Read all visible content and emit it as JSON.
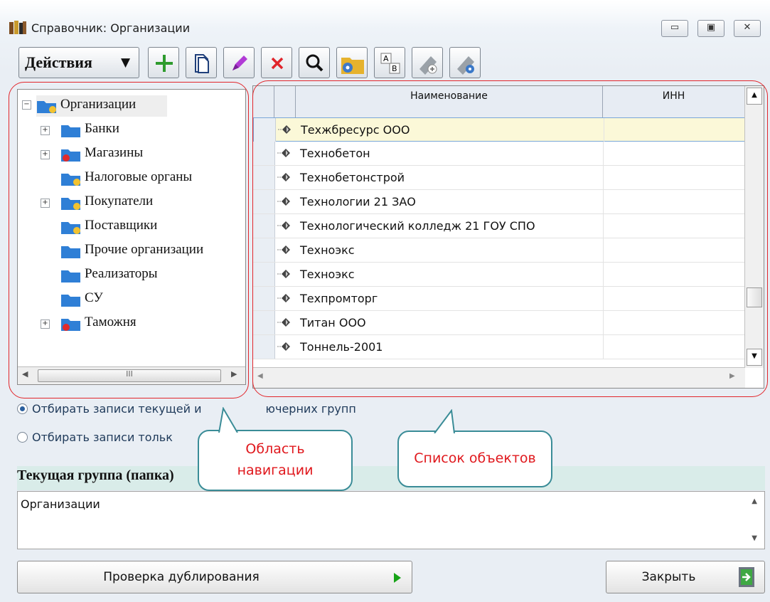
{
  "window": {
    "title": "Справочник: Организации",
    "controls": {
      "minimize": "▭",
      "restore": "▣",
      "close": "✕"
    }
  },
  "toolbar": {
    "actions_label": "Действия",
    "buttons": [
      "add-icon",
      "copy-icon",
      "edit-icon",
      "delete-icon",
      "search-icon",
      "folder-settings-icon",
      "sort-ab-icon",
      "usb-add-icon",
      "usb-settings-icon"
    ]
  },
  "tree": {
    "root": "Организации",
    "items": [
      {
        "label": "Банки",
        "expandable": true,
        "icon": "folder-blue-icon"
      },
      {
        "label": "Магазины",
        "expandable": true,
        "icon": "folder-stop-icon"
      },
      {
        "label": "Налоговые органы",
        "expandable": false,
        "icon": "folder-locked-icon"
      },
      {
        "label": "Покупатели",
        "expandable": true,
        "icon": "folder-locked-icon"
      },
      {
        "label": "Поставщики",
        "expandable": false,
        "icon": "folder-locked-icon"
      },
      {
        "label": "Прочие организации",
        "expandable": false,
        "icon": "folder-blue-icon"
      },
      {
        "label": "Реализаторы",
        "expandable": false,
        "icon": "folder-blue-icon"
      },
      {
        "label": "СУ",
        "expandable": false,
        "icon": "folder-blue-icon"
      },
      {
        "label": "Таможня",
        "expandable": true,
        "icon": "folder-stop-icon"
      }
    ],
    "scroll_mark": "III"
  },
  "grid": {
    "columns": [
      "Наименование",
      "ИНН"
    ],
    "rows": [
      {
        "name": "Техжбресурс ООО",
        "inn": "",
        "selected": true
      },
      {
        "name": "Технобетон",
        "inn": ""
      },
      {
        "name": "Технобетонстрой",
        "inn": ""
      },
      {
        "name": "Технологии 21 ЗАО",
        "inn": ""
      },
      {
        "name": "Технологический колледж 21 ГОУ СПО",
        "inn": ""
      },
      {
        "name": "Техноэкс",
        "inn": ""
      },
      {
        "name": "Техноэкс",
        "inn": ""
      },
      {
        "name": "Техпромторг",
        "inn": ""
      },
      {
        "name": "Титан ООО",
        "inn": ""
      },
      {
        "name": "Тоннель-2001",
        "inn": ""
      }
    ]
  },
  "filters": {
    "option1": "Отбирать записи текущей и подчинённых групп",
    "option2": "Отбирать записи только текущей группы",
    "option1_visible": "Отбирать записи текущей и",
    "option1_tail": "ючерних групп",
    "option2_visible": "Отбирать записи тольк"
  },
  "current_group": {
    "heading": "Текущая группа (папка)",
    "value": "Организации"
  },
  "buttons": {
    "check_duplicates": "Проверка дублирования",
    "close": "Закрыть"
  },
  "annotations": {
    "nav_area": "Область навигации",
    "nav_line1": "Область",
    "nav_line2": "навигации",
    "object_list": "Список объектов"
  },
  "colors": {
    "selected_row": "#fbf8d8",
    "annotation_text": "#e0181d",
    "callout_border": "#3a8c97",
    "group_header_bg": "#d9ece9"
  }
}
